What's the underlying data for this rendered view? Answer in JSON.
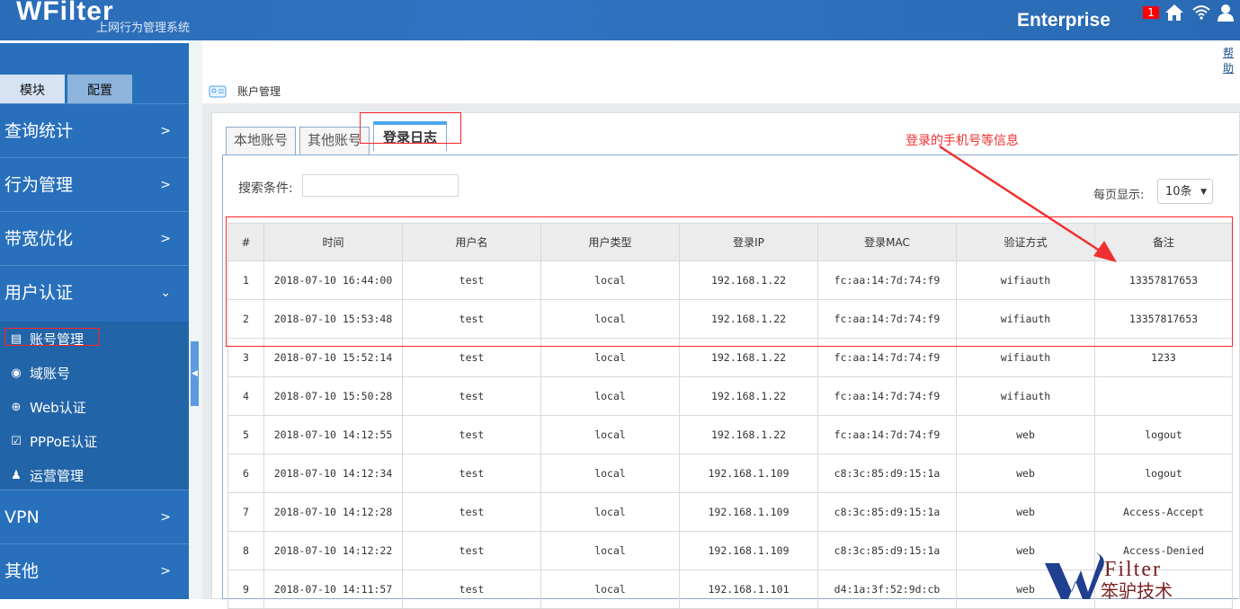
{
  "header": {
    "logo": "WFilter",
    "subtitle": "上网行为管理系统",
    "edition": "Enterprise",
    "notification_count": "1",
    "icons": [
      "home-icon",
      "wifi-icon",
      "user-icon"
    ]
  },
  "sidebar": {
    "tabs": [
      "模块",
      "配置"
    ],
    "menu": [
      {
        "label": "查询统计",
        "chev": ">"
      },
      {
        "label": "行为管理",
        "chev": ">"
      },
      {
        "label": "带宽优化",
        "chev": ">"
      },
      {
        "label": "用户认证",
        "chev": "⌄"
      },
      {
        "label": "VPN",
        "chev": ">"
      },
      {
        "label": "其他",
        "chev": ">"
      }
    ],
    "submenu": [
      {
        "label": "账号管理",
        "icon": "id-card-icon"
      },
      {
        "label": "域账号",
        "icon": "domain-icon"
      },
      {
        "label": "Web认证",
        "icon": "globe-icon"
      },
      {
        "label": "PPPoE认证",
        "icon": "pppoe-icon"
      },
      {
        "label": "运营管理",
        "icon": "operator-icon"
      }
    ]
  },
  "help_link": "帮助",
  "breadcrumb": "账户管理",
  "tabs": [
    "本地账号",
    "其他账号",
    "登录日志"
  ],
  "active_tab": "登录日志",
  "search": {
    "label": "搜索条件:",
    "value": ""
  },
  "page_size": {
    "label": "每页显示:",
    "value": "10条"
  },
  "annotation": "登录的手机号等信息",
  "table": {
    "headers": [
      "#",
      "时间",
      "用户名",
      "用户类型",
      "登录IP",
      "登录MAC",
      "验证方式",
      "备注"
    ],
    "rows": [
      [
        "1",
        "2018-07-10 16:44:00",
        "test",
        "local",
        "192.168.1.22",
        "fc:aa:14:7d:74:f9",
        "wifiauth",
        "13357817653"
      ],
      [
        "2",
        "2018-07-10 15:53:48",
        "test",
        "local",
        "192.168.1.22",
        "fc:aa:14:7d:74:f9",
        "wifiauth",
        "13357817653"
      ],
      [
        "3",
        "2018-07-10 15:52:14",
        "test",
        "local",
        "192.168.1.22",
        "fc:aa:14:7d:74:f9",
        "wifiauth",
        "1233"
      ],
      [
        "4",
        "2018-07-10 15:50:28",
        "test",
        "local",
        "192.168.1.22",
        "fc:aa:14:7d:74:f9",
        "wifiauth",
        ""
      ],
      [
        "5",
        "2018-07-10 14:12:55",
        "test",
        "local",
        "192.168.1.22",
        "fc:aa:14:7d:74:f9",
        "web",
        "logout"
      ],
      [
        "6",
        "2018-07-10 14:12:34",
        "test",
        "local",
        "192.168.1.109",
        "c8:3c:85:d9:15:1a",
        "web",
        "logout"
      ],
      [
        "7",
        "2018-07-10 14:12:28",
        "test",
        "local",
        "192.168.1.109",
        "c8:3c:85:d9:15:1a",
        "web",
        "Access-Accept"
      ],
      [
        "8",
        "2018-07-10 14:12:22",
        "test",
        "local",
        "192.168.1.109",
        "c8:3c:85:d9:15:1a",
        "web",
        "Access-Denied"
      ],
      [
        "9",
        "2018-07-10 14:11:57",
        "test",
        "local",
        "192.168.1.101",
        "d4:1a:3f:52:9d:cb",
        "web",
        ""
      ]
    ]
  },
  "watermark": {
    "brand": "Filter",
    "text": "笨驴技术"
  },
  "colors": {
    "header": "#2a6cb8",
    "sidebar": "#2870bc",
    "highlight": "#ff2222",
    "active_tab": "#4ca8f0"
  }
}
